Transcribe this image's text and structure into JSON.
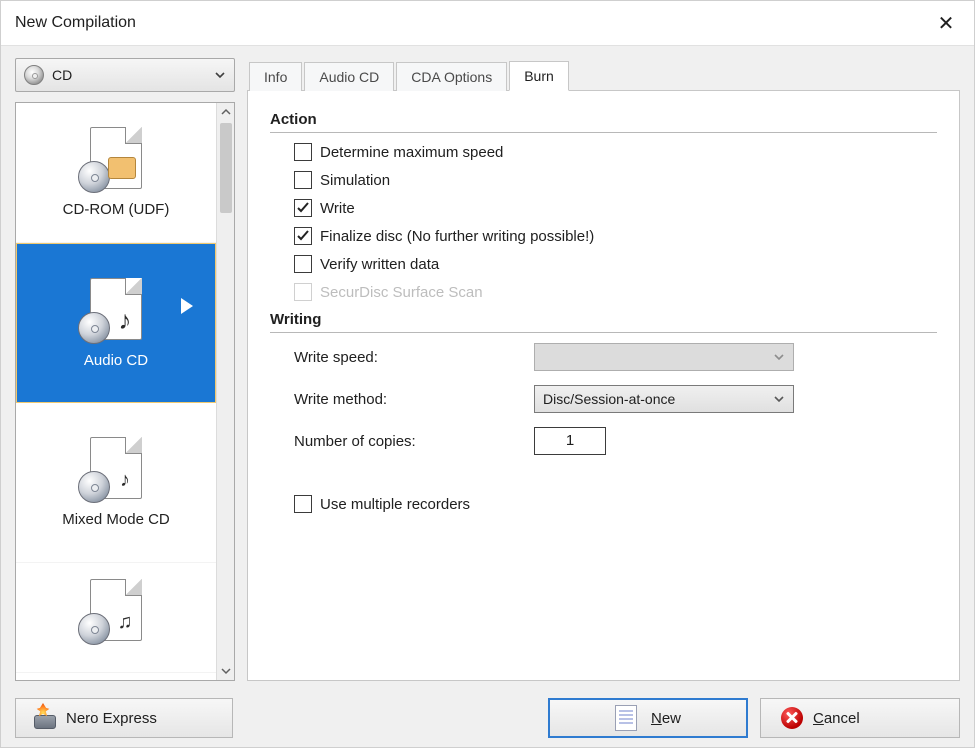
{
  "window": {
    "title": "New Compilation"
  },
  "mediaSelect": {
    "label": "CD"
  },
  "types": {
    "item0": {
      "label": "CD-ROM (UDF)"
    },
    "item1": {
      "label": "Audio CD"
    },
    "item2": {
      "label": "Mixed Mode CD"
    }
  },
  "tabs": {
    "t0": "Info",
    "t1": "Audio CD",
    "t2": "CDA Options",
    "t3": "Burn"
  },
  "sections": {
    "action": "Action",
    "writing": "Writing"
  },
  "checks": {
    "maxspeed": {
      "label": "Determine maximum speed",
      "checked": false,
      "disabled": false
    },
    "simulation": {
      "label": "Simulation",
      "checked": false,
      "disabled": false
    },
    "write": {
      "label": "Write",
      "checked": true,
      "disabled": false
    },
    "finalize": {
      "label": "Finalize disc (No further writing possible!)",
      "checked": true,
      "disabled": false
    },
    "verify": {
      "label": "Verify written data",
      "checked": false,
      "disabled": false
    },
    "securdisc": {
      "label": "SecurDisc Surface Scan",
      "checked": false,
      "disabled": true
    },
    "multirec": {
      "label": "Use multiple recorders",
      "checked": false,
      "disabled": false
    }
  },
  "writing": {
    "speed_label": "Write speed:",
    "speed_value": "",
    "method_label": "Write method:",
    "method_value": "Disc/Session-at-once",
    "copies_label": "Number of copies:",
    "copies_value": "1"
  },
  "footer": {
    "nero": "Nero Express",
    "new": "New",
    "cancel": "Cancel"
  }
}
